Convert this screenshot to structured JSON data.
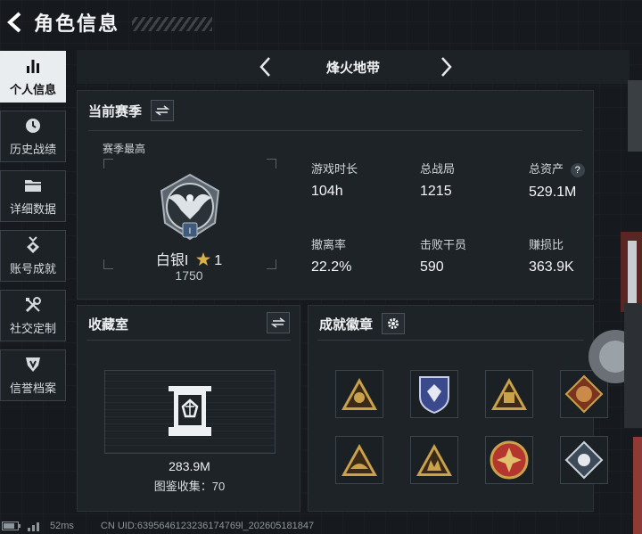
{
  "header": {
    "title": "角色信息",
    "back_icon": "chevron-left-icon"
  },
  "sidebar": {
    "items": [
      {
        "label": "个人信息",
        "icon": "bar-chart-icon",
        "active": true
      },
      {
        "label": "历史战绩",
        "icon": "clock-icon",
        "active": false
      },
      {
        "label": "详细数据",
        "icon": "folder-icon",
        "active": false
      },
      {
        "label": "账号成就",
        "icon": "medal-icon",
        "active": false
      },
      {
        "label": "社交定制",
        "icon": "tools-icon",
        "active": false
      },
      {
        "label": "信誉档案",
        "icon": "shield-icon",
        "active": false
      }
    ]
  },
  "map_selector": {
    "name": "烽火地带"
  },
  "season": {
    "title": "当前赛季",
    "best_label": "赛季最高",
    "rank_name": "白银I",
    "rank_stars": "1",
    "rank_score": "1750",
    "stats": [
      {
        "label": "游戏时长",
        "value": "104h"
      },
      {
        "label": "总战局",
        "value": "1215"
      },
      {
        "label": "总资产",
        "value": "529.1M",
        "help": "?"
      },
      {
        "label": "撤离率",
        "value": "22.2%"
      },
      {
        "label": "击败干员",
        "value": "590"
      },
      {
        "label": "赚损比",
        "value": "363.9K"
      }
    ]
  },
  "collection": {
    "title": "收藏室",
    "value": "283.9M",
    "catalog_label": "图鉴收集：70"
  },
  "achievements": {
    "title": "成就徽章",
    "badge_count": 8
  },
  "footer": {
    "latency": "52ms",
    "uid": "CN UID:6395646123236174769l_202605181847"
  },
  "colors": {
    "active_tab_bg": "#e9edf0",
    "panel_bg": "#1f2429",
    "gold": "#c9a24a",
    "accent_red": "#b5352f"
  }
}
